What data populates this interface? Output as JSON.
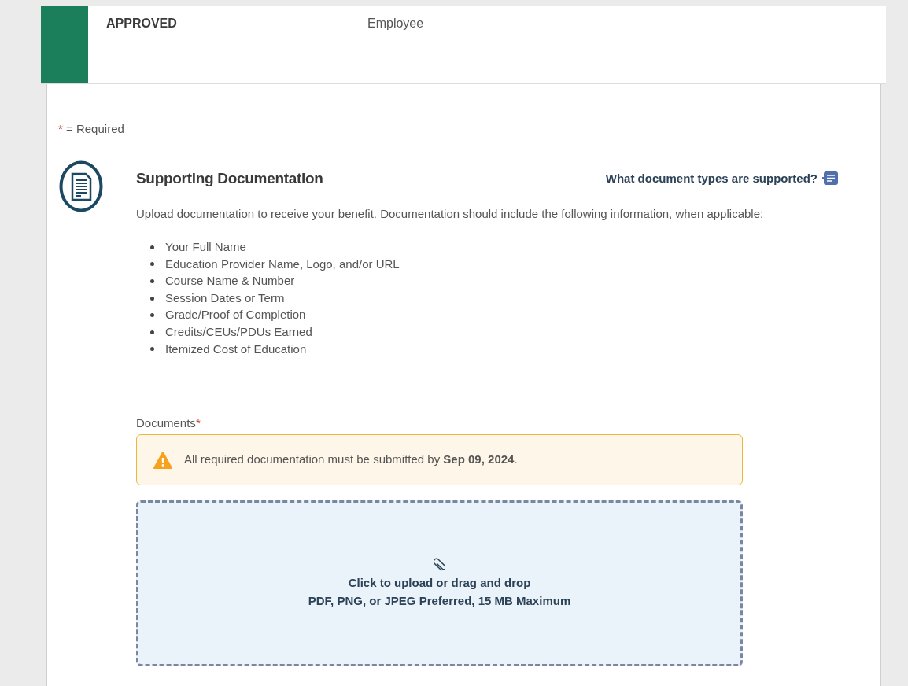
{
  "status_card": {
    "status": "APPROVED",
    "role": "Employee"
  },
  "required_note": {
    "marker": "*",
    "text": "= Required"
  },
  "section": {
    "title": "Supporting Documentation",
    "help_link": "What document types are supported?",
    "intro": "Upload documentation to receive your benefit. Documentation should include the following information, when applicable:",
    "items": [
      "Your Full Name",
      "Education Provider Name, Logo, and/or URL",
      "Course Name & Number",
      "Session Dates or Term",
      "Grade/Proof of Completion",
      "Credits/CEUs/PDUs Earned",
      "Itemized Cost of Education"
    ]
  },
  "documents": {
    "label": "Documents",
    "marker": "*",
    "warning": "All required documentation must be submitted by **Sep 09, 2024**.",
    "upload_title": "Click to upload or drag and drop",
    "upload_hint": "PDF, PNG, or JPEG Preferred, 15 MB Maximum"
  }
}
